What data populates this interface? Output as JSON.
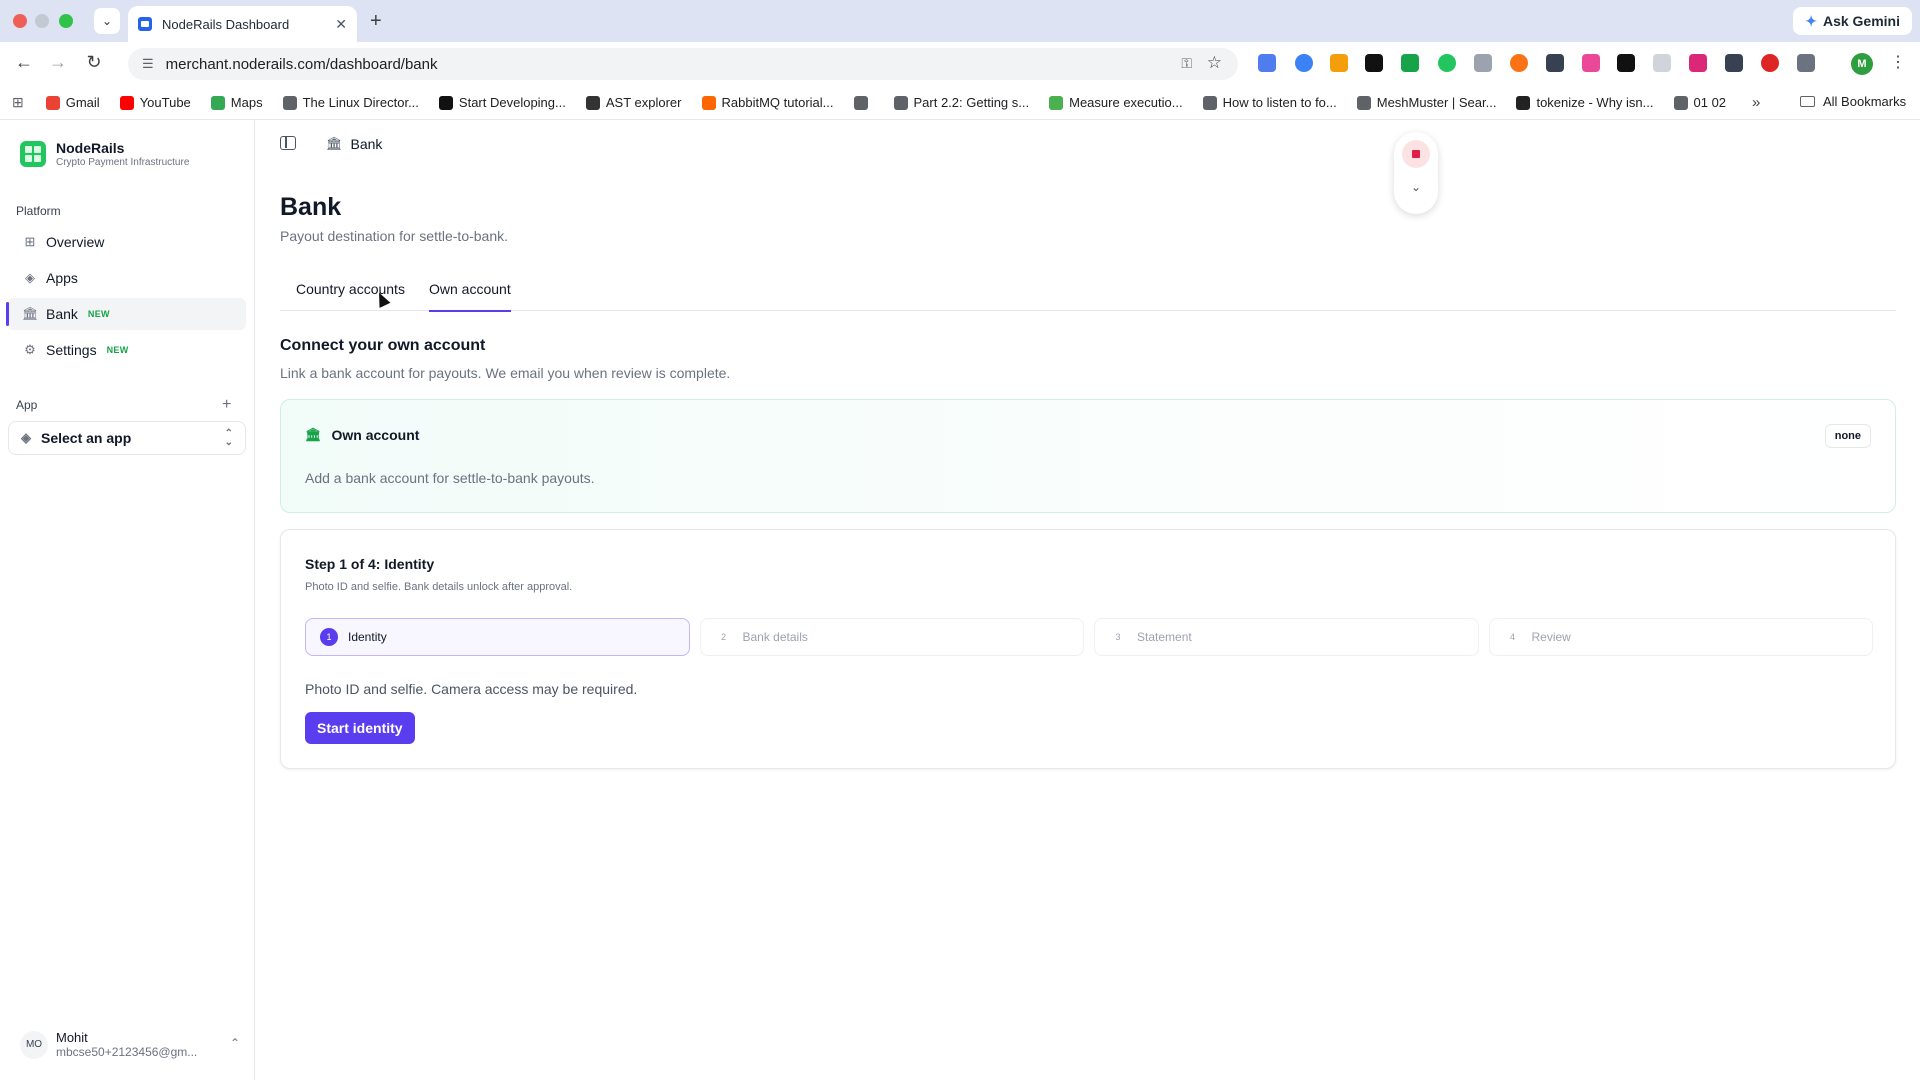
{
  "browser": {
    "tab_title": "NodeRails Dashboard",
    "new_tab": "+",
    "ask_gemini": "Ask Gemini",
    "url": "merchant.noderails.com/dashboard/bank",
    "profile_initial": "M",
    "bookmarks": [
      {
        "label": "Gmail",
        "color": "#ea4335"
      },
      {
        "label": "YouTube",
        "color": "#ff0000"
      },
      {
        "label": "Maps",
        "color": "#34a853"
      },
      {
        "label": "The Linux Director...",
        "color": "#5f6368"
      },
      {
        "label": "Start Developing...",
        "color": "#111111"
      },
      {
        "label": "AST explorer",
        "color": "#333333"
      },
      {
        "label": "RabbitMQ tutorial...",
        "color": "#ff6600"
      },
      {
        "label": "",
        "color": "#5f6368"
      },
      {
        "label": "Part 2.2: Getting s...",
        "color": "#5f6368"
      },
      {
        "label": "Measure executio...",
        "color": "#4caf50"
      },
      {
        "label": "How to listen to fo...",
        "color": "#5f6368"
      },
      {
        "label": "MeshMuster | Sear...",
        "color": "#5f6368"
      },
      {
        "label": "tokenize - Why isn...",
        "color": "#222222"
      },
      {
        "label": "01 02",
        "color": "#5f6368"
      }
    ],
    "bookmarks_more": "»",
    "all_bookmarks": "All Bookmarks"
  },
  "sidebar": {
    "brand_name": "NodeRails",
    "brand_sub": "Crypto Payment Infrastructure",
    "platform_label": "Platform",
    "items": [
      {
        "label": "Overview",
        "badge": ""
      },
      {
        "label": "Apps",
        "badge": ""
      },
      {
        "label": "Bank",
        "badge": "NEW"
      },
      {
        "label": "Settings",
        "badge": "NEW"
      }
    ],
    "app_label": "App",
    "select_app": "Select an app",
    "user_initials": "MO",
    "user_name": "Mohit",
    "user_email": "mbcse50+2123456@gm..."
  },
  "header": {
    "breadcrumb": "Bank"
  },
  "page": {
    "title": "Bank",
    "subtitle": "Payout destination for settle-to-bank.",
    "tabs": [
      "Country accounts",
      "Own account"
    ],
    "active_tab": "Own account",
    "section_title": "Connect your own account",
    "section_sub": "Link a bank account for payouts. We email you when review is complete.",
    "own_account_card": {
      "title": "Own account",
      "status": "none",
      "description": "Add a bank account for settle-to-bank payouts."
    },
    "step_card": {
      "title": "Step 1 of 4: Identity",
      "subtitle": "Photo ID and selfie. Bank details unlock after approval.",
      "steps": [
        {
          "num": "1",
          "label": "Identity"
        },
        {
          "num": "2",
          "label": "Bank details"
        },
        {
          "num": "3",
          "label": "Statement"
        },
        {
          "num": "4",
          "label": "Review"
        }
      ],
      "active_step": 1,
      "description": "Photo ID and selfie. Camera access may be required.",
      "button": "Start identity"
    }
  },
  "theme": {
    "accent": "#5b3df0",
    "brand_green": "#22c55e"
  }
}
